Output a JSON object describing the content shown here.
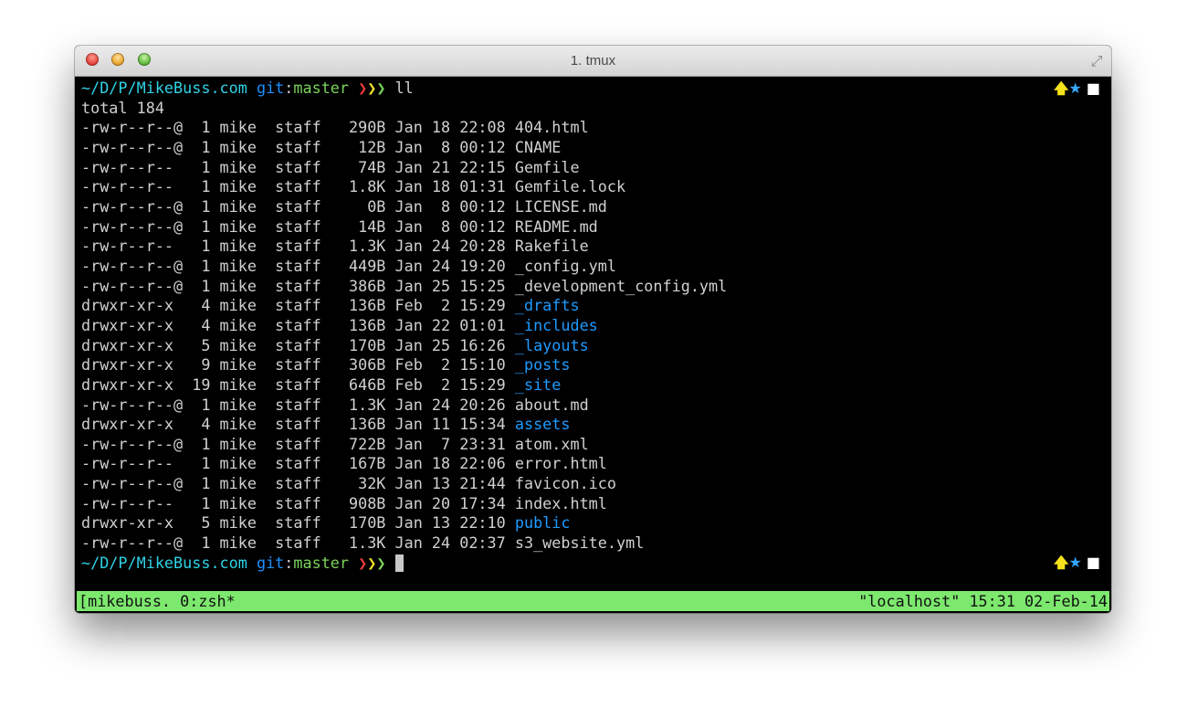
{
  "window": {
    "title": "1. tmux"
  },
  "prompt": {
    "cwd": "~/D/P/MikeBuss.com",
    "git": "git",
    "colon": ":",
    "branch": "master",
    "arrows": [
      "❯",
      "❯",
      "❯"
    ],
    "command": "ll"
  },
  "indicators": {
    "up": "🡅",
    "star": "★",
    "square": "■"
  },
  "total": "total 184",
  "rows": [
    {
      "prefix": "-rw-r--r--@  1 mike  staff   290B Jan 18 22:08 ",
      "name": "404.html",
      "dir": false
    },
    {
      "prefix": "-rw-r--r--@  1 mike  staff    12B Jan  8 00:12 ",
      "name": "CNAME",
      "dir": false
    },
    {
      "prefix": "-rw-r--r--   1 mike  staff    74B Jan 21 22:15 ",
      "name": "Gemfile",
      "dir": false
    },
    {
      "prefix": "-rw-r--r--   1 mike  staff   1.8K Jan 18 01:31 ",
      "name": "Gemfile.lock",
      "dir": false
    },
    {
      "prefix": "-rw-r--r--@  1 mike  staff     0B Jan  8 00:12 ",
      "name": "LICENSE.md",
      "dir": false
    },
    {
      "prefix": "-rw-r--r--@  1 mike  staff    14B Jan  8 00:12 ",
      "name": "README.md",
      "dir": false
    },
    {
      "prefix": "-rw-r--r--   1 mike  staff   1.3K Jan 24 20:28 ",
      "name": "Rakefile",
      "dir": false
    },
    {
      "prefix": "-rw-r--r--@  1 mike  staff   449B Jan 24 19:20 ",
      "name": "_config.yml",
      "dir": false
    },
    {
      "prefix": "-rw-r--r--@  1 mike  staff   386B Jan 25 15:25 ",
      "name": "_development_config.yml",
      "dir": false
    },
    {
      "prefix": "drwxr-xr-x   4 mike  staff   136B Feb  2 15:29 ",
      "name": "_drafts",
      "dir": true
    },
    {
      "prefix": "drwxr-xr-x   4 mike  staff   136B Jan 22 01:01 ",
      "name": "_includes",
      "dir": true
    },
    {
      "prefix": "drwxr-xr-x   5 mike  staff   170B Jan 25 16:26 ",
      "name": "_layouts",
      "dir": true
    },
    {
      "prefix": "drwxr-xr-x   9 mike  staff   306B Feb  2 15:10 ",
      "name": "_posts",
      "dir": true
    },
    {
      "prefix": "drwxr-xr-x  19 mike  staff   646B Feb  2 15:29 ",
      "name": "_site",
      "dir": true
    },
    {
      "prefix": "-rw-r--r--@  1 mike  staff   1.3K Jan 24 20:26 ",
      "name": "about.md",
      "dir": false
    },
    {
      "prefix": "drwxr-xr-x   4 mike  staff   136B Jan 11 15:34 ",
      "name": "assets",
      "dir": true
    },
    {
      "prefix": "-rw-r--r--@  1 mike  staff   722B Jan  7 23:31 ",
      "name": "atom.xml",
      "dir": false
    },
    {
      "prefix": "-rw-r--r--   1 mike  staff   167B Jan 18 22:06 ",
      "name": "error.html",
      "dir": false
    },
    {
      "prefix": "-rw-r--r--@  1 mike  staff    32K Jan 13 21:44 ",
      "name": "favicon.ico",
      "dir": false
    },
    {
      "prefix": "-rw-r--r--   1 mike  staff   908B Jan 20 17:34 ",
      "name": "index.html",
      "dir": false
    },
    {
      "prefix": "drwxr-xr-x   5 mike  staff   170B Jan 13 22:10 ",
      "name": "public",
      "dir": true
    },
    {
      "prefix": "-rw-r--r--@  1 mike  staff   1.3K Jan 24 02:37 ",
      "name": "s3_website.yml",
      "dir": false
    }
  ],
  "statusbar": {
    "left": "[mikebuss. 0:zsh*",
    "right": "\"localhost\" 15:31 02-Feb-14",
    "color": "#7de86e"
  },
  "colors": {
    "cwd": "#2fd3e6",
    "git": "#1e90ff",
    "branch": "#7ad35a",
    "directory": "#1e9bff",
    "arrow_red": "#ec3b3b",
    "arrow_yellow": "#f2e12b",
    "arrow_green": "#7ad35a"
  }
}
